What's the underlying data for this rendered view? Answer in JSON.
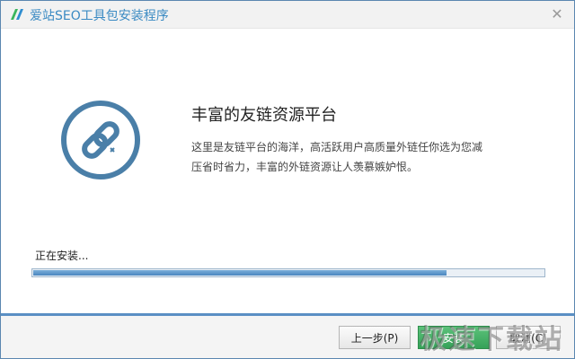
{
  "window": {
    "title": "爱站SEO工具包安装程序",
    "close_glyph": "✕"
  },
  "content": {
    "heading": "丰富的友链资源平台",
    "description": "这里是友链平台的海洋，高活跃用户高质量外链任你选为您减压省时省力，丰富的外链资源让人羡慕嫉妒恨。"
  },
  "progress": {
    "status": "正在安装...",
    "value": 0.81
  },
  "buttons": {
    "back": "上一步(P)",
    "next": "安装",
    "cancel": "取消(C)"
  },
  "watermark": "极速下载站",
  "colors": {
    "accent": "#3a8ac3",
    "logo": "#4a7fa8",
    "footer_rule": "#5a8fc4"
  },
  "icons": {
    "app": "aizhan-logo-icon",
    "logo": "chain-link-icon",
    "close": "close-icon"
  }
}
